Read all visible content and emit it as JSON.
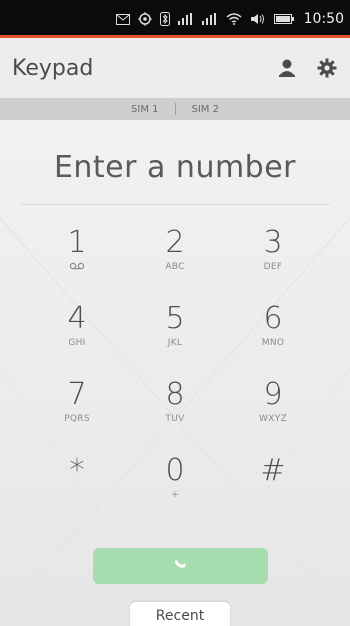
{
  "status_bar": {
    "time": "10:50",
    "icons": [
      "mail-icon",
      "location-icon",
      "bluetooth-icon",
      "signal-icon",
      "signal-icon",
      "wifi-icon",
      "volume-icon",
      "battery-icon"
    ]
  },
  "header": {
    "title": "Keypad",
    "actions": [
      "contacts-icon",
      "settings-icon"
    ]
  },
  "sim_selector": {
    "sims": [
      "SIM 1",
      "SIM 2"
    ]
  },
  "entry": {
    "placeholder": "Enter a number"
  },
  "keypad": {
    "keys": [
      {
        "digit": "1",
        "letters": ""
      },
      {
        "digit": "2",
        "letters": "ABC"
      },
      {
        "digit": "3",
        "letters": "DEF"
      },
      {
        "digit": "4",
        "letters": "GHI"
      },
      {
        "digit": "5",
        "letters": "JKL"
      },
      {
        "digit": "6",
        "letters": "MNO"
      },
      {
        "digit": "7",
        "letters": "PQRS"
      },
      {
        "digit": "8",
        "letters": "TUV"
      },
      {
        "digit": "9",
        "letters": "WXYZ"
      },
      {
        "digit": "*",
        "letters": ""
      },
      {
        "digit": "0",
        "letters": "+"
      },
      {
        "digit": "#",
        "letters": ""
      }
    ]
  },
  "call_button": {
    "icon": "phone-icon",
    "color": "#a7dcb1"
  },
  "bottom_tab": {
    "label": "Recent"
  },
  "colors": {
    "accent": "#e9532f",
    "call": "#a7dcb1"
  }
}
